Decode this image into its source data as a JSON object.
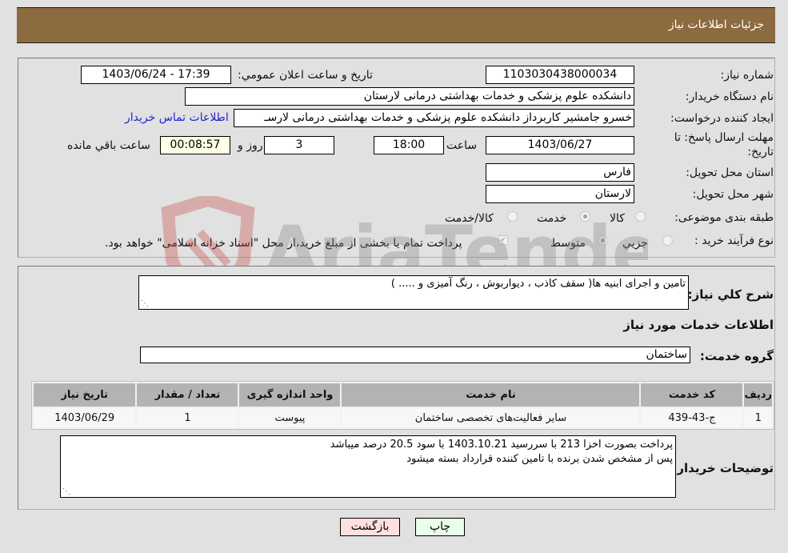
{
  "header": {
    "title": "جزئیات اطلاعات نیاز"
  },
  "fields": {
    "need_number": {
      "label": "شماره نیاز:",
      "value": "1103030438000034"
    },
    "announce_datetime": {
      "label": "تاریخ و ساعت اعلان عمومي:",
      "value": "1403/06/24 - 17:39"
    },
    "buyer_org": {
      "label": "نام دستگاه خريدار:",
      "value": "دانشکده علوم پزشکی و خدمات بهداشتی  درمانی لارستان"
    },
    "requester": {
      "label": "ایجاد کننده درخواست:",
      "value": "خسرو جامشیر کاربرداز دانشکده علوم پزشکی و خدمات بهداشتی  درمانی لارسـ"
    },
    "contact_link": "اطلاعات تماس خریدار",
    "deadline": {
      "label_line1": "مهلت ارسال پاسخ: تا",
      "label_line2": "تاریخ:",
      "date": "1403/06/27",
      "time_label": "ساعت",
      "time": "18:00",
      "days": "3",
      "days_label": "روز و",
      "remaining": "00:08:57",
      "remaining_label": "ساعت باقي مانده"
    },
    "province": {
      "label": "استان محل تحویل:",
      "value": "فارس"
    },
    "city": {
      "label": "شهر محل تحویل:",
      "value": "لارستان"
    },
    "category": {
      "label": "طبقه بندی موضوعی:",
      "options": [
        "کالا",
        "خدمت",
        "کالا/خدمت"
      ],
      "selected": "خدمت"
    },
    "purchase_type": {
      "label": "نوع فرآیند خرید :",
      "options": [
        "جزيي",
        "متوسط"
      ],
      "selected": "متوسط",
      "treasury_note": "پرداخت تمام یا بخشی از مبلغ خرید،از محل \"اسناد خزانه اسلامی\" خواهد بود.",
      "treasury_checked": true
    }
  },
  "general_description": {
    "label": "شرح کلي نياز:",
    "value": "تامین و اجرای ابنیه ها( سقف کاذب ، دیواربوش ، رنگ آمیزی و  .....    )"
  },
  "services_section_title": "اطلاعات خدمات مورد نياز",
  "service_group": {
    "label": "گروه خدمت:",
    "value": "ساختمان"
  },
  "services_table": {
    "columns": [
      "رديف",
      "کد خدمت",
      "نام خدمت",
      "واحد اندازه گیری",
      "تعداد / مقدار",
      "تاریخ نیاز"
    ],
    "rows": [
      [
        "1",
        "ج-43-439",
        "سایر فعالیت‌های تخصصی ساختمان",
        "پیوست",
        "1",
        "1403/06/29"
      ]
    ]
  },
  "buyer_notes": {
    "label": "توضیحات خریدار:",
    "line1": "پرداخت بصورت اخزا  213 با سررسید 1403.10.21 با سود 20.5 درصد میباشد",
    "line2": "پس از مشخص شدن برنده با تامین کننده قرارداد بسته میشود"
  },
  "buttons": {
    "print": "چاپ",
    "back": "بازگشت"
  },
  "watermark": "AriaTender.neT",
  "colors": {
    "header_bg": "#8c6b41",
    "link": "#2222cc",
    "print_bg": "#eaffea",
    "back_bg": "#ffe0e0",
    "remaining_bg": "#ffffe6"
  }
}
